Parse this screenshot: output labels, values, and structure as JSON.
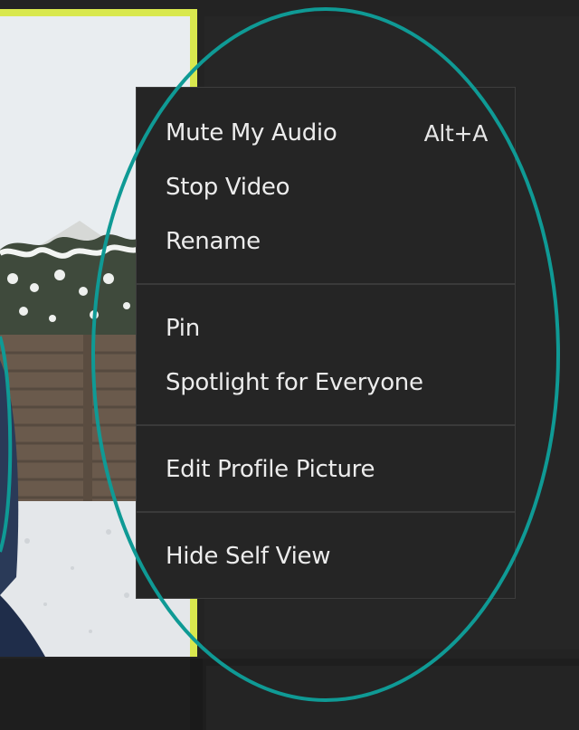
{
  "context_menu": {
    "items": [
      {
        "label": "Mute My Audio",
        "shortcut": "Alt+A"
      },
      {
        "label": "Stop Video"
      },
      {
        "label": "Rename"
      },
      {
        "label": "Pin"
      },
      {
        "label": "Spotlight for Everyone"
      },
      {
        "label": "Edit Profile Picture"
      },
      {
        "label": "Hide Self View"
      }
    ]
  },
  "colors": {
    "tile_border": "#d9e84e",
    "annotation_ring": "#0f9a95",
    "menu_background": "#252525",
    "menu_text": "#ececec"
  },
  "icons": {
    "video_content": "self-video-feed"
  }
}
